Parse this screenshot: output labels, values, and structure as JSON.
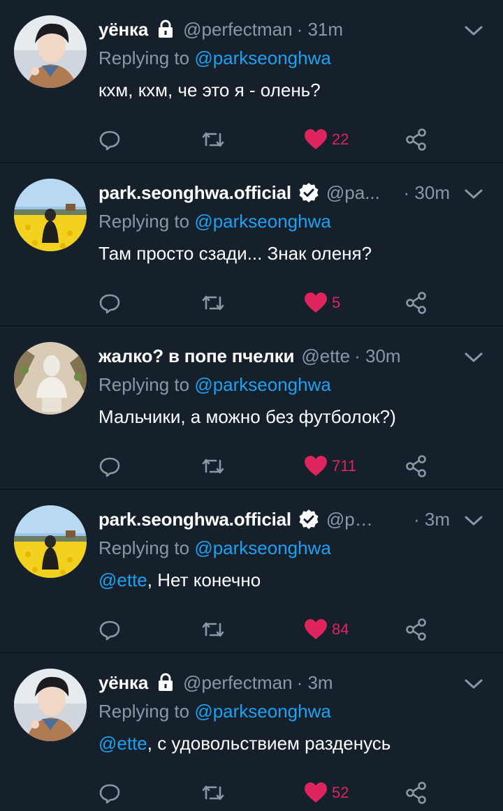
{
  "colors": {
    "background": "#15202b",
    "secondary_text": "#8899a6",
    "link": "#1da1f2",
    "like": "#e0245e"
  },
  "tweets": [
    {
      "name": "уёнка",
      "badge": "lock-icon",
      "handle": "@perfectman",
      "time": "· 31m",
      "replying_prefix": "Replying to",
      "replying_to": "@parkseonghwa",
      "mention": "",
      "text": "кхм, кхм, че это я - олень?",
      "likes": "22",
      "avatar": "portrait-avatar"
    },
    {
      "name": "park.seonghwa.official",
      "badge": "verified-icon",
      "handle": "@pa...",
      "time": "· 30m",
      "replying_prefix": "Replying to",
      "replying_to": "@parkseonghwa",
      "mention": "",
      "text": "Там просто сзади... Знак оленя?",
      "likes": "5",
      "avatar": "flower-field-avatar"
    },
    {
      "name": "жалко? в попе пчелки",
      "badge": "",
      "handle": "@ette",
      "time": "· 30m",
      "replying_prefix": "Replying to",
      "replying_to": "@parkseonghwa",
      "mention": "",
      "text": "Мальчики, а можно без футболок?)",
      "likes": "711",
      "avatar": "statue-avatar"
    },
    {
      "name": "park.seonghwa.official",
      "badge": "verified-icon",
      "handle": "@par...",
      "time": "· 3m",
      "replying_prefix": "Replying to",
      "replying_to": "@parkseonghwa",
      "mention": "@ette",
      "text": ", Нет конечно",
      "likes": "84",
      "avatar": "flower-field-avatar"
    },
    {
      "name": "уёнка",
      "badge": "lock-icon",
      "handle": "@perfectman",
      "time": "· 3m",
      "replying_prefix": "Replying to",
      "replying_to": "@parkseonghwa",
      "mention": "@ette",
      "text": ", с удовольствием разденусь",
      "likes": "52",
      "avatar": "portrait-avatar"
    }
  ]
}
